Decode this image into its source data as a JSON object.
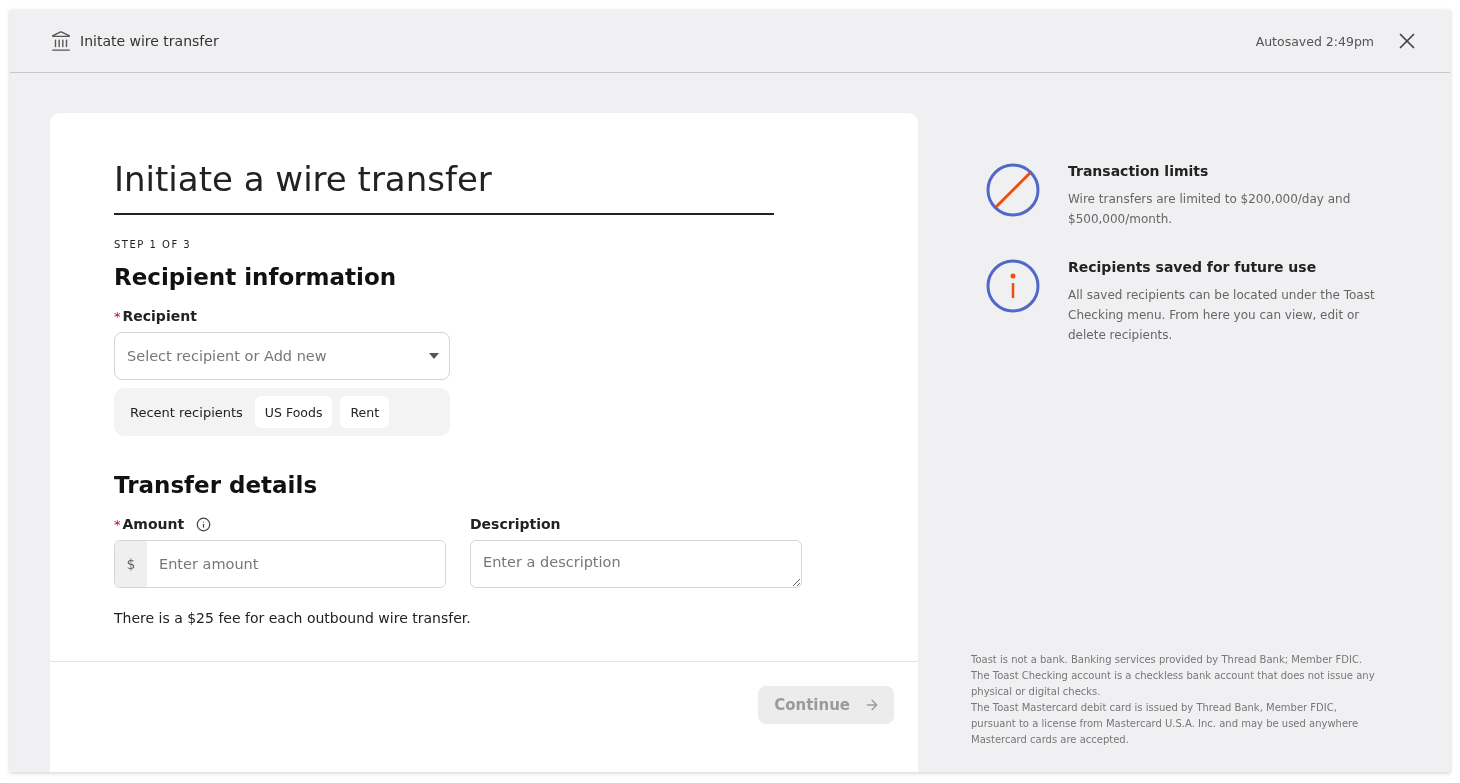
{
  "header": {
    "title": "Initate wire transfer",
    "autosave": "Autosaved 2:49pm"
  },
  "form": {
    "title": "Initiate a wire transfer",
    "step": "STEP 1 OF 3",
    "recipient_section": {
      "heading": "Recipient information",
      "label": "Recipient",
      "required_mark": "*",
      "placeholder": "Select recipient or Add new",
      "recent_label": "Recent recipients",
      "recent": [
        "US Foods",
        "Rent"
      ]
    },
    "transfer_section": {
      "heading": "Transfer details",
      "amount": {
        "label": "Amount",
        "required_mark": "*",
        "prefix": "$",
        "placeholder": "Enter amount"
      },
      "description": {
        "label": "Description",
        "placeholder": "Enter a description"
      },
      "note": "There is a $25 fee for each outbound wire transfer."
    },
    "continue_button": {
      "label": "Continue",
      "disabled": true
    }
  },
  "info": [
    {
      "kind": "limit",
      "title": "Transaction limits",
      "text": "Wire transfers are limited to $200,000/day and $500,000/month."
    },
    {
      "kind": "info",
      "title": "Recipients saved for future use",
      "text": "All saved recipients can be located under the Toast Checking menu. From here you can view, edit or delete recipients."
    }
  ],
  "disclaimer": [
    "Toast is not a bank. Banking services provided by Thread Bank; Member FDIC.",
    "The Toast Checking account is a checkless bank account that does not issue any physical or digital checks.",
    "The Toast Mastercard debit card is issued by Thread Bank, Member FDIC, pursuant to a license from Mastercard U.S.A. Inc. and may be used anywhere Mastercard cards are accepted."
  ]
}
